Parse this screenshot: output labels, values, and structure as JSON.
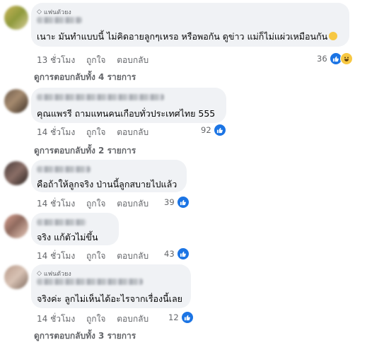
{
  "fan_badge_label": "แฟนตัวยง",
  "comments": [
    {
      "text": "เนาะ มันทำแบบนี้ ไม่คิดอายลูกๆเหรอ หรือพอกัน ดูข่าว แม่ก็ไม่แผ่วเหมือนกัน",
      "emoji": "smiling-face",
      "time": "13 ชั่วโมง",
      "like": "ถูกใจ",
      "reply": "ตอบกลับ",
      "reactions": "36",
      "replies": "ดูการตอบกลับทั้ง 4 รายการ",
      "fan": true
    },
    {
      "text": "คุณแพรรี ถามแทนคนเกือบทั่วประเทศไทย 555",
      "time": "14 ชั่วโมง",
      "like": "ถูกใจ",
      "reply": "ตอบกลับ",
      "reactions": "92",
      "replies": "ดูการตอบกลับทั้ง 2 รายการ",
      "fan": false
    },
    {
      "text": "คือถ้าให้ลูกจริง ป่านนี้ลูกสบายไปแล้ว",
      "time": "14 ชั่วโมง",
      "like": "ถูกใจ",
      "reply": "ตอบกลับ",
      "reactions": "39",
      "fan": false
    },
    {
      "text": "จริง แก้ตัวไม่ขึ้น",
      "time": "14 ชั่วโมง",
      "like": "ถูกใจ",
      "reply": "ตอบกลับ",
      "reactions": "43",
      "fan": false
    },
    {
      "text": "จริงค่ะ ลูกไม่เห็นได้อะไรจากเรื่องนี้เลย",
      "time": "14 ชั่วโมง",
      "like": "ถูกใจ",
      "reply": "ตอบกลับ",
      "reactions": "12",
      "replies": "ดูการตอบกลับทั้ง 3 รายการ",
      "fan": true
    }
  ],
  "colors": {
    "bubble": "#f0f2f5",
    "meta_text": "#65676b",
    "like_blue": "#1b74e4",
    "haha_yellow": "#f7c843"
  }
}
